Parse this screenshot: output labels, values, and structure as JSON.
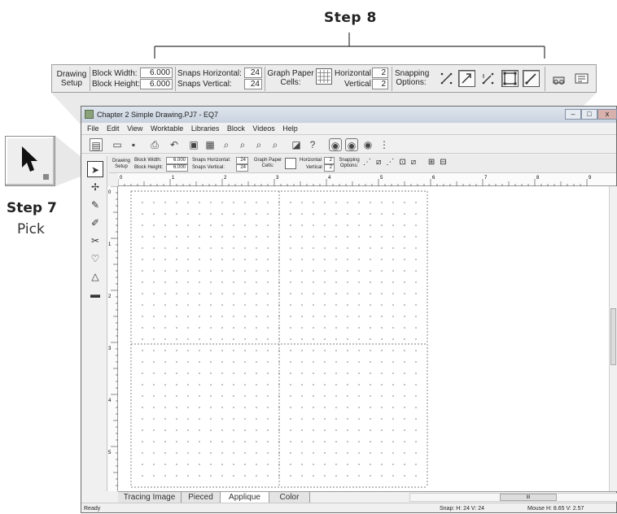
{
  "callouts": {
    "step8": "Step 8",
    "step7": "Step 7",
    "pick": "Pick"
  },
  "toolbar": {
    "drawing_setup_1": "Drawing",
    "drawing_setup_2": "Setup",
    "block_width_label": "Block Width:",
    "block_width_value": "6.000",
    "block_height_label": "Block Height:",
    "block_height_value": "6.000",
    "snaps_horizontal_label": "Snaps Horizontal:",
    "snaps_horizontal_value": "24",
    "snaps_vertical_label": "Snaps Vertical:",
    "snaps_vertical_value": "24",
    "graph_paper_label_1": "Graph Paper",
    "graph_paper_label_2": "Cells:",
    "horizontal_label": "Horizontal",
    "horizontal_value": "2",
    "vertical_label": "Vertical",
    "vertical_value": "2",
    "snapping_label_1": "Snapping",
    "snapping_label_2": "Options:"
  },
  "window": {
    "title": "Chapter 2 Simple Drawing.PJ7 - EQ7",
    "menu": [
      "File",
      "Edit",
      "View",
      "Worktable",
      "Libraries",
      "Block",
      "Videos",
      "Help"
    ]
  },
  "ruler": {
    "h_labels": [
      "0",
      "1",
      "2",
      "3",
      "4",
      "5",
      "6",
      "7",
      "8",
      "9"
    ],
    "v_labels": [
      "0",
      "1",
      "2",
      "3",
      "4",
      "5",
      "6"
    ]
  },
  "tabs": [
    "Tracing Image",
    "Pieced",
    "Applique",
    "Color"
  ],
  "status": {
    "ready": "Ready",
    "snap": "Snap:   H: 24   V: 24",
    "mouse": "Mouse  H: 8.65  V: 2.57"
  },
  "scroll_mark": "III",
  "icons": {
    "pick_tool": "arrow-pointer-icon",
    "shape_tool": "shape-pointer-icon",
    "pencil": "pencil-icon",
    "bezier": "bezier-icon",
    "snap_icons": [
      "snap-grid-icon",
      "snap-node-icon",
      "snap-both-icon",
      "snap-frame-icon",
      "snap-line-icon"
    ]
  }
}
